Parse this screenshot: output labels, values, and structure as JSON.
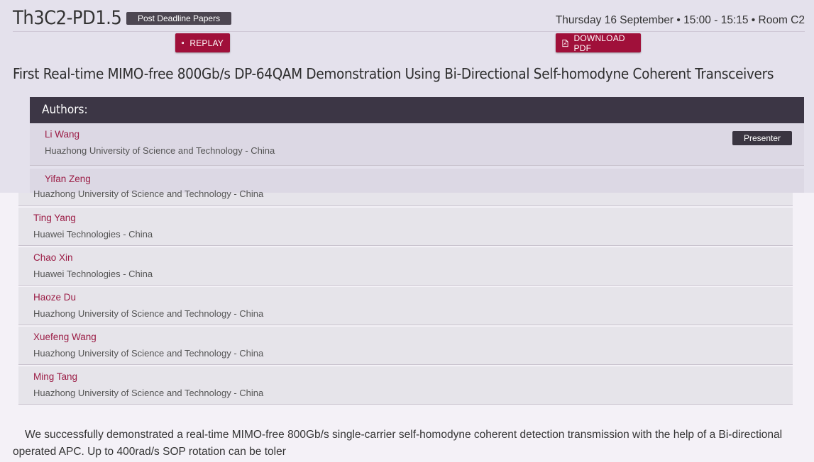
{
  "session": {
    "code": "Th3C2-PD1.5",
    "category": "Post Deadline Papers",
    "datetime": "Thursday 16 September • 15:00 - 15:15 • Room C2"
  },
  "buttons": {
    "replay": "REPLAY",
    "download": "DOWNLOAD PDF"
  },
  "paper": {
    "title": "First Real-time MIMO-free 800Gb/s DP-64QAM Demonstration Using Bi-Directional Self-homodyne Coherent Transceivers"
  },
  "authors_heading": "Authors:",
  "presenter_label": "Presenter",
  "authors": [
    {
      "name": "Li Wang",
      "affiliation": "Huazhong University of Science and Technology - China"
    },
    {
      "name": "Yifan Zeng",
      "affiliation": "Huazhong University of Science and Technology - China"
    },
    {
      "name": "Ting Yang",
      "affiliation": "Huawei Technologies - China"
    },
    {
      "name": "Chao Xin",
      "affiliation": "Huawei Technologies - China"
    },
    {
      "name": "Haoze Du",
      "affiliation": "Huazhong University of Science and Technology - China"
    },
    {
      "name": "Xuefeng Wang",
      "affiliation": "Huazhong University of Science and Technology - China"
    },
    {
      "name": "Ming Tang",
      "affiliation": "Huazhong University of Science and Technology - China"
    }
  ],
  "abstract": {
    "line1": "We successfully demonstrated a real-time MIMO-free 800Gb/s single-carrier self-homodyne coherent detection transmission with the help of a Bi-directional",
    "line2": "operated APC. Up to 400rad/s SOP rotation can be toler"
  },
  "colors": {
    "accent": "#a0103a",
    "header_dark": "#3c3645",
    "author_name": "#9b1c45"
  }
}
